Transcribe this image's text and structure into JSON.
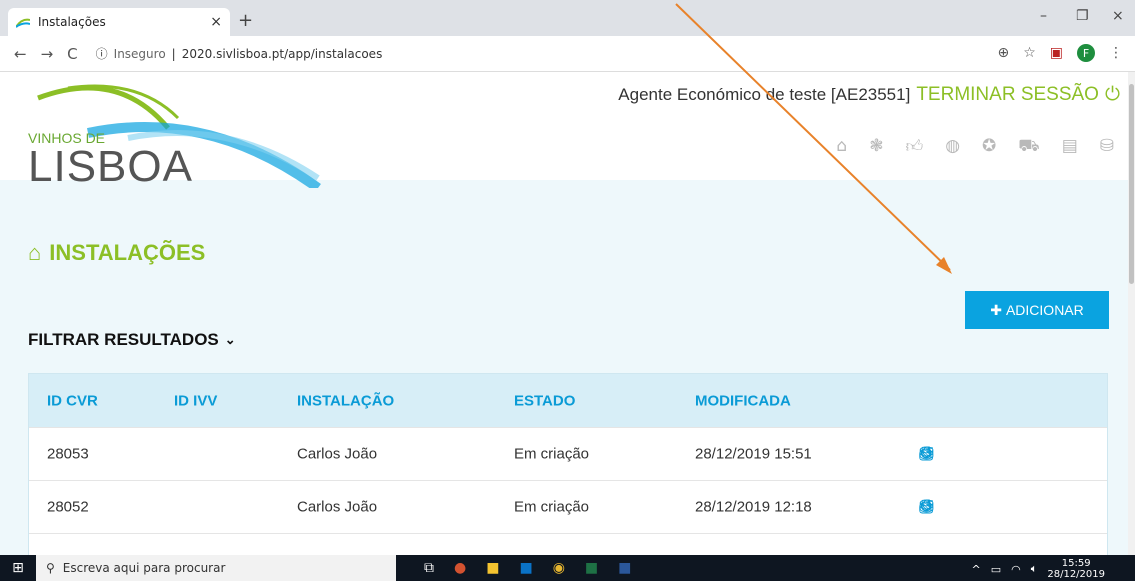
{
  "browser": {
    "tab_title": "Instalações",
    "url_prefix": "Inseguro",
    "url": "2020.sivlisboa.pt/app/instalacoes",
    "profile_initial": "F"
  },
  "header": {
    "logo_top": "VINHOS DE",
    "logo_main": "LISBOA",
    "agent": "Agente Económico de teste [AE23551]",
    "logout": "TERMINAR SESSÃO"
  },
  "page": {
    "title": "INSTALAÇÕES",
    "add_button": "ADICIONAR",
    "filter_label": "FILTRAR RESULTADOS"
  },
  "table": {
    "headers": [
      "ID CVR",
      "ID IVV",
      "INSTALAÇÃO",
      "ESTADO",
      "MODIFICADA"
    ],
    "rows": [
      {
        "id_cvr": "28053",
        "id_ivv": "",
        "instalacao": "Carlos João",
        "estado": "Em criação",
        "modificada": "28/12/2019 15:51"
      },
      {
        "id_cvr": "28052",
        "id_ivv": "",
        "instalacao": "Carlos João",
        "estado": "Em criação",
        "modificada": "28/12/2019 12:18"
      }
    ]
  },
  "taskbar": {
    "search_placeholder": "Escreva aqui para procurar",
    "time": "15:59",
    "date": "28/12/2019"
  },
  "colors": {
    "accent": "#8cbf26",
    "primary": "#0aa3e0",
    "arrow": "#e8822a"
  }
}
